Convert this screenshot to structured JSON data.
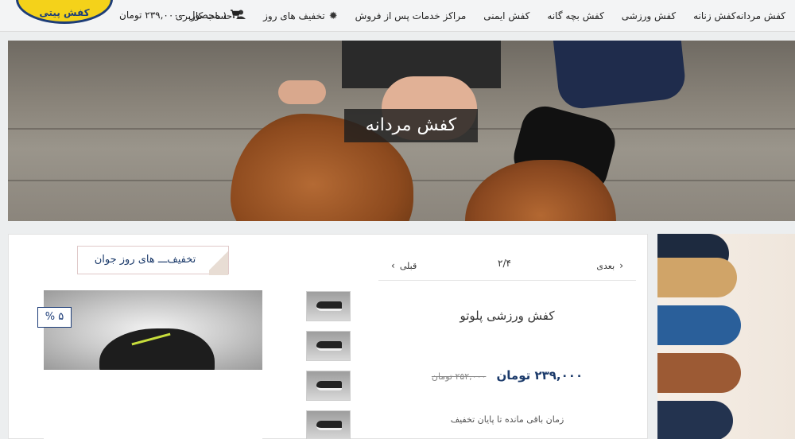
{
  "logo": {
    "text": "کفش پیتی"
  },
  "nav": {
    "items": [
      {
        "label": "کفش مردانه"
      },
      {
        "label": "کفش زنانه"
      },
      {
        "label": "کفش ورزشی"
      },
      {
        "label": "کفش بچه گانه"
      },
      {
        "label": "کفش ایمنی"
      },
      {
        "label": "مراکز خدمات پس از فروش"
      }
    ],
    "deals": {
      "label": "تخفیف های روز",
      "icon": "gear-icon"
    },
    "account": {
      "label": "حساب کاربری",
      "icon": "user-icon"
    },
    "cart": {
      "label": "۱ محصول - ۲۳۹,۰۰۰ تومان",
      "icon": "cart-icon"
    }
  },
  "hero": {
    "title": "کفش مردانه"
  },
  "deals_heading": {
    "label": "تخفیف‌ـــ های روز جوان"
  },
  "pager": {
    "next_label": "بعدی",
    "prev_label": "قبلی",
    "count": "۲/۴"
  },
  "product": {
    "title": "کفش ورزشی پلوتو",
    "price_new": "۲۳۹,۰۰۰ تومان",
    "price_old": "۲۵۲,۰۰۰ تومان",
    "timer_label": "زمان باقی مانده تا پایان تخفیف",
    "discount_badge": "۵ %"
  },
  "colors": {
    "brand_blue": "#1d3d78",
    "logo_yellow": "#f4d21a"
  }
}
